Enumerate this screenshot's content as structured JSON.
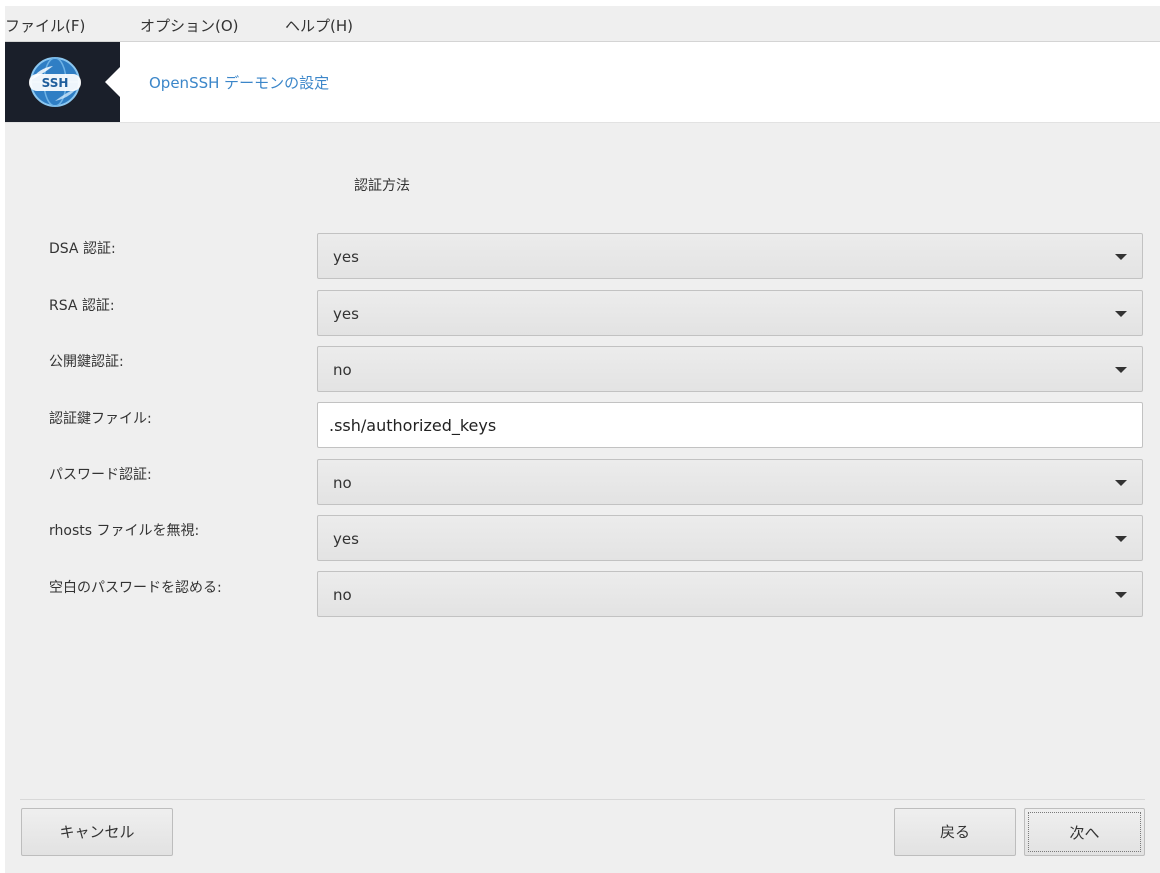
{
  "menubar": {
    "items": [
      {
        "label": "ファイル(F)"
      },
      {
        "label": "オプション(O)"
      },
      {
        "label": "ヘルプ(H)"
      }
    ]
  },
  "banner": {
    "logo_text": "SSH",
    "title": "OpenSSH デーモンの設定",
    "logo_icon": "ssh-globe-icon"
  },
  "section_title": "認証方法",
  "fields": {
    "dsa": {
      "label": "DSA 認証:",
      "value": "yes"
    },
    "rsa": {
      "label": "RSA 認証:",
      "value": "yes"
    },
    "pubkey": {
      "label": "公開鍵認証:",
      "value": "no"
    },
    "keyfile": {
      "label": "認証鍵ファイル:",
      "value": ".ssh/authorized_keys"
    },
    "password": {
      "label": "パスワード認証:",
      "value": "no"
    },
    "rhosts": {
      "label": "rhosts ファイルを無視:",
      "value": "yes"
    },
    "empty_password": {
      "label": "空白のパスワードを認める:",
      "value": "no"
    }
  },
  "buttons": {
    "cancel": "キャンセル",
    "back": "戻る",
    "next": "次へ"
  },
  "colors": {
    "accent": "#3b86c9",
    "logo_bg": "#1a1f2a"
  }
}
